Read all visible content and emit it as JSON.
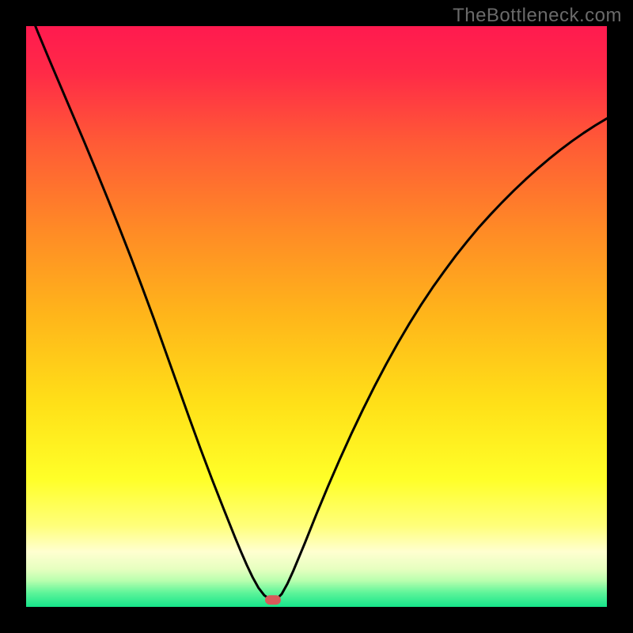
{
  "watermark": "TheBottleneck.com",
  "colors": {
    "frame": "#000000",
    "curve": "#000000",
    "marker": "#d85a5a"
  },
  "gradient_stops": [
    {
      "offset": 0.0,
      "color": "#ff1a4f"
    },
    {
      "offset": 0.08,
      "color": "#ff2a47"
    },
    {
      "offset": 0.2,
      "color": "#ff5a36"
    },
    {
      "offset": 0.35,
      "color": "#ff8a26"
    },
    {
      "offset": 0.5,
      "color": "#ffb61a"
    },
    {
      "offset": 0.65,
      "color": "#ffe018"
    },
    {
      "offset": 0.78,
      "color": "#ffff28"
    },
    {
      "offset": 0.86,
      "color": "#ffff7a"
    },
    {
      "offset": 0.905,
      "color": "#ffffd0"
    },
    {
      "offset": 0.935,
      "color": "#e6ffc0"
    },
    {
      "offset": 0.955,
      "color": "#b8ffae"
    },
    {
      "offset": 0.975,
      "color": "#60f59a"
    },
    {
      "offset": 1.0,
      "color": "#16e48a"
    }
  ],
  "chart_data": {
    "type": "line",
    "title": "",
    "xlabel": "",
    "ylabel": "",
    "xlim": [
      0,
      100
    ],
    "ylim": [
      0,
      100
    ],
    "marker": {
      "x": 42.5,
      "y": 1.2
    },
    "series": [
      {
        "name": "left-branch",
        "x": [
          0,
          2,
          4,
          6,
          8,
          10,
          12,
          14,
          16,
          18,
          20,
          22,
          24,
          26,
          28,
          30,
          32,
          34,
          36,
          37,
          38,
          39,
          40,
          41,
          42,
          43
        ],
        "y": [
          104,
          99,
          94.2,
          89.5,
          84.8,
          80.1,
          75.3,
          70.4,
          65.4,
          60.3,
          55.0,
          49.6,
          44.0,
          38.4,
          32.8,
          27.3,
          22.0,
          16.9,
          11.9,
          9.5,
          7.2,
          5.1,
          3.3,
          2.0,
          1.3,
          1.2
        ]
      },
      {
        "name": "right-branch",
        "x": [
          43,
          44,
          45,
          46,
          48,
          50,
          52,
          54,
          56,
          58,
          60,
          62,
          64,
          66,
          68,
          70,
          72,
          74,
          76,
          78,
          80,
          82,
          84,
          86,
          88,
          90,
          92,
          94,
          96,
          98,
          100
        ],
        "y": [
          1.2,
          2.2,
          4.0,
          6.2,
          11.0,
          16.0,
          20.8,
          25.4,
          29.8,
          34.0,
          38.0,
          41.8,
          45.4,
          48.8,
          52.0,
          55.0,
          57.8,
          60.5,
          63.0,
          65.4,
          67.6,
          69.7,
          71.7,
          73.6,
          75.4,
          77.1,
          78.7,
          80.2,
          81.6,
          82.9,
          84.1
        ]
      }
    ]
  }
}
